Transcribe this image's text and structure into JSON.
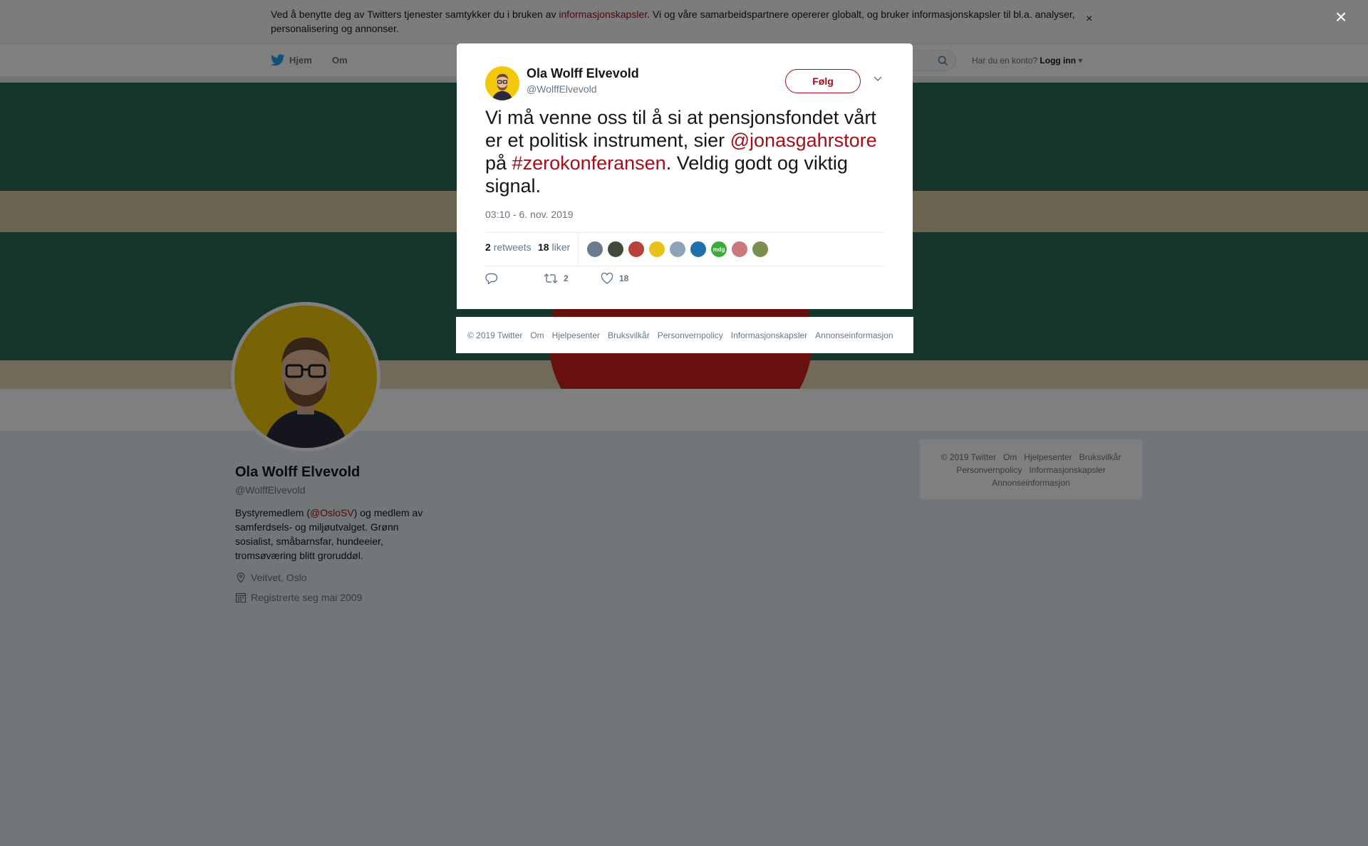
{
  "cookie_bar": {
    "text_before": "Ved å benytte deg av Twitters tjenester samtykker du i bruken av ",
    "link": "informasjonskapsler",
    "text_after": ". Vi og våre samarbeidspartnere opererer globalt, og bruker informasjonskapsler til bl.a. analyser, personalisering og annonser.",
    "close": "×"
  },
  "nav": {
    "home": "Hjem",
    "about": "Om",
    "have_account": "Har du en konto?",
    "login": "Logg inn"
  },
  "page_close": "×",
  "profile": {
    "name": "Ola Wolff Elvevold",
    "handle": "@WolffElvevold",
    "bio_before": "Bystyremedlem (",
    "bio_link": "@OsloSV",
    "bio_after": ") og medlem av samferdsels- og miljøutvalget. Grønn sosialist, småbarnsfar, hundeeier, tromsøværing blitt groruddøl.",
    "location": "Veitvet, Oslo",
    "joined": "Registrerte seg mai 2009"
  },
  "side_footer": {
    "links": [
      "© 2019 Twitter",
      "Om",
      "Hjelpesenter",
      "Bruksvilkår",
      "Personvernpolicy",
      "Informasjonskapsler",
      "Annonseinformasjon"
    ]
  },
  "tweet": {
    "author_name": "Ola Wolff Elvevold",
    "author_handle": "@WolffElvevold",
    "follow_label": "Følg",
    "text_part1": "Vi må venne oss til å si at pensjonsfondet vårt er et politisk instrument, sier ",
    "mention": "@jonasgahrstore",
    "text_part2": " på ",
    "hashtag": "#zerokonferansen",
    "text_part3": ". Veldig godt og viktig signal.",
    "timestamp": "03:10 - 6. nov. 2019",
    "retweets_count": "2",
    "retweets_label": "retweets",
    "likes_count": "18",
    "likes_label": "liker",
    "liker_avatars": [
      "#6b7b8c",
      "#3f4a3c",
      "#b8413a",
      "#e8c21a",
      "#8fa3b8",
      "#1f6fa8",
      "#3bab3b",
      "#c9787b",
      "#7a8e52"
    ],
    "liker_avatar_badge": "mdg",
    "action_retweet_count": "2",
    "action_like_count": "18"
  },
  "modal_footer": {
    "links": [
      "© 2019 Twitter",
      "Om",
      "Hjelpesenter",
      "Bruksvilkår",
      "Personvernpolicy",
      "Informasjonskapsler",
      "Annonseinformasjon"
    ]
  },
  "colors": {
    "accent": "#a0101a",
    "secondary_text": "#657786",
    "avatar_yellow": "#f2c90a"
  }
}
